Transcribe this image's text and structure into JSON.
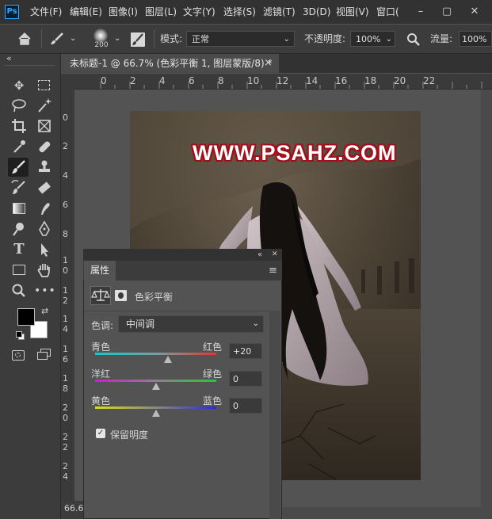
{
  "menubar": {
    "app_icon": "Ps",
    "items": [
      "文件(F)",
      "编辑(E)",
      "图像(I)",
      "图层(L)",
      "文字(Y)",
      "选择(S)",
      "滤镜(T)",
      "3D(D)",
      "视图(V)",
      "窗口("
    ],
    "window_controls": {
      "minimize": "–",
      "restore": "▢",
      "close": "✕"
    }
  },
  "options": {
    "brush_size": "200",
    "mode_label": "模式:",
    "mode_value": "正常",
    "opacity_label": "不透明度:",
    "opacity_value": "100%",
    "flow_label": "流量:",
    "flow_value": "100%"
  },
  "document": {
    "tab_title": "未标题-1 @ 66.7% (色彩平衡 1, 图层蒙版/8) *",
    "tab_close": "×",
    "zoom_status": "66.6",
    "ruler_top": [
      "0",
      "2",
      "4",
      "6",
      "8",
      "10",
      "12",
      "14",
      "16",
      "18",
      "20",
      "22"
    ],
    "ruler_left": [
      [
        "0"
      ],
      [
        "2"
      ],
      [
        "4"
      ],
      [
        "6"
      ],
      [
        "8"
      ],
      [
        "1",
        "0"
      ],
      [
        "1",
        "2"
      ],
      [
        "1",
        "4"
      ],
      [
        "1",
        "6"
      ],
      [
        "1",
        "8"
      ],
      [
        "2",
        "0"
      ],
      [
        "2",
        "2"
      ],
      [
        "2",
        "4"
      ]
    ],
    "watermark": "WWW.PSAHZ.COM"
  },
  "toolbar": {
    "collapse": "«"
  },
  "panel": {
    "collapse": "«",
    "close": "✕",
    "tab_label": "属性",
    "menu_icon": "≡",
    "adjustment_title": "色彩平衡",
    "tone_label": "色调:",
    "tone_value": "中间调",
    "sliders": [
      {
        "left": "青色",
        "right": "红色",
        "value": "+20",
        "level": 20
      },
      {
        "left": "洋红",
        "right": "绿色",
        "value": "0",
        "level": 0
      },
      {
        "left": "黄色",
        "right": "蓝色",
        "value": "0",
        "level": 0
      }
    ],
    "preserve_luminosity": "保留明度",
    "preserve_checked": true
  },
  "colors": {
    "foreground": "#000000",
    "background": "#ffffff",
    "watermark_outline": "#a1101a"
  }
}
